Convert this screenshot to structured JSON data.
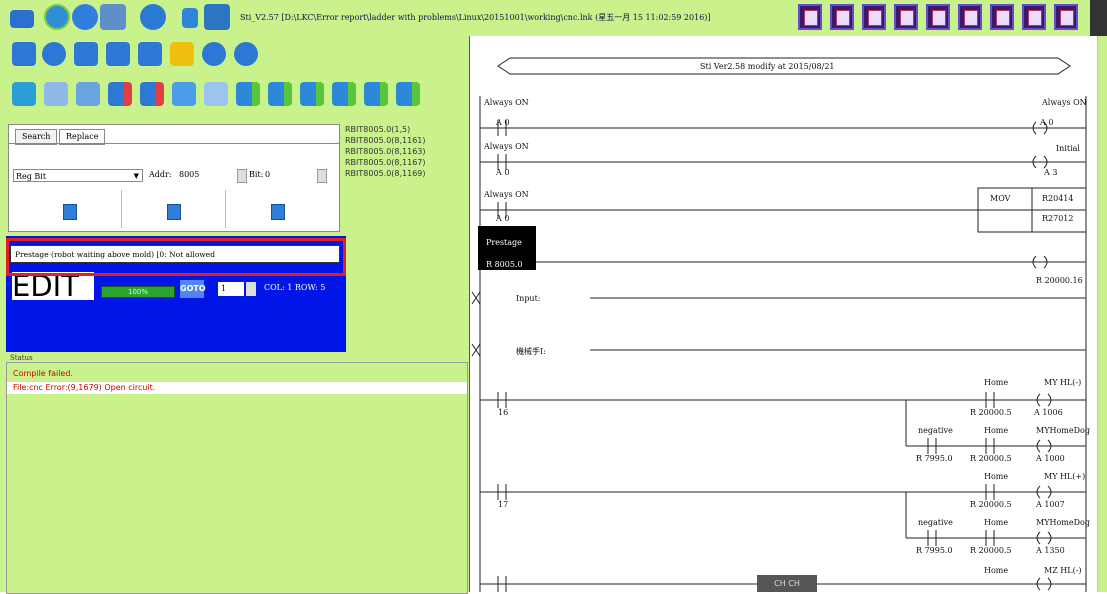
{
  "window": {
    "title": "Sti_V2.57 [D:\\LKC\\Error report\\ladder with problems\\Linux\\20151001\\working\\cnc.lnk (星五一月 15 11:02:59 2016)]"
  },
  "search": {
    "tabs": [
      "Search",
      "Replace"
    ],
    "type_value": "Reg Bit",
    "addr_label": "Addr:",
    "addr_value": "8005",
    "bit_label": "Bit:",
    "bit_value": "0"
  },
  "register_list": [
    "RBIT8005.0(1,5)",
    "RBIT8005.0(8,1161)",
    "RBIT8005.0(8,1163)",
    "RBIT8005.0(8,1167)",
    "RBIT8005.0(8,1169)"
  ],
  "blue_panel": {
    "description": "Prestage (robot waiting above mold) [0: Not allowed",
    "mode": "EDIT",
    "progress_label": "100%",
    "progress_value": 1.0,
    "goto_label": "GOTO",
    "goto_value": "1",
    "col_row": "COL: 1 ROW: 5"
  },
  "status": {
    "header": "Status",
    "lines": [
      "Compile failed.",
      "File:cnc Error:(9,1679) Open circuit."
    ]
  },
  "ladder": {
    "header": "Sti Ver2.58 modify at 2015/08/21",
    "labels": {
      "r1_in_name": "Always ON",
      "r1_in_addr": "A 0",
      "r1_out_name": "Always ON",
      "r1_out_addr": "A 0",
      "r2_in_name": "Always ON",
      "r2_in_addr": "A 0",
      "r2_out_name": "Initial",
      "r2_out_addr": "A 3",
      "r3_in_name": "Always ON",
      "r3_in_addr": "A 0",
      "mov": "MOV",
      "mov_src": "R20414",
      "mov_dst": "R27012",
      "r4_in_name": "Prestage",
      "r4_in_addr": "R 8005.0",
      "r4_out_addr": "R 20000.16",
      "input_label": "Input:",
      "manual_label": "機械手I:",
      "c16": "16",
      "c17": "17",
      "home1": "Home",
      "home1_addr": "R 20000.5",
      "out1_name": "MY HL(-)",
      "out1_addr": "A 1006",
      "neg1": "negative",
      "neg1_addr": "R 7995.0",
      "home2": "Home",
      "home2_addr": "R 20000.5",
      "out2_name": "MYHomeDog",
      "out2_addr": "A 1000",
      "home3": "Home",
      "home3_addr": "R 20000.5",
      "out3_name": "MY HL(+)",
      "out3_addr": "A 1007",
      "neg2": "negative",
      "neg2_addr": "R 7995.0",
      "home4": "Home",
      "home4_addr": "R 20000.5",
      "out4_name": "MYHomeDog",
      "out4_addr": "A 1350",
      "home5": "Home",
      "out5_name": "MZ HL(-)"
    }
  },
  "status_chip": "CH CH",
  "colors": {
    "lime": "#c9f28d",
    "blue_panel": "#0015e6",
    "highlight_red": "#e32020"
  }
}
